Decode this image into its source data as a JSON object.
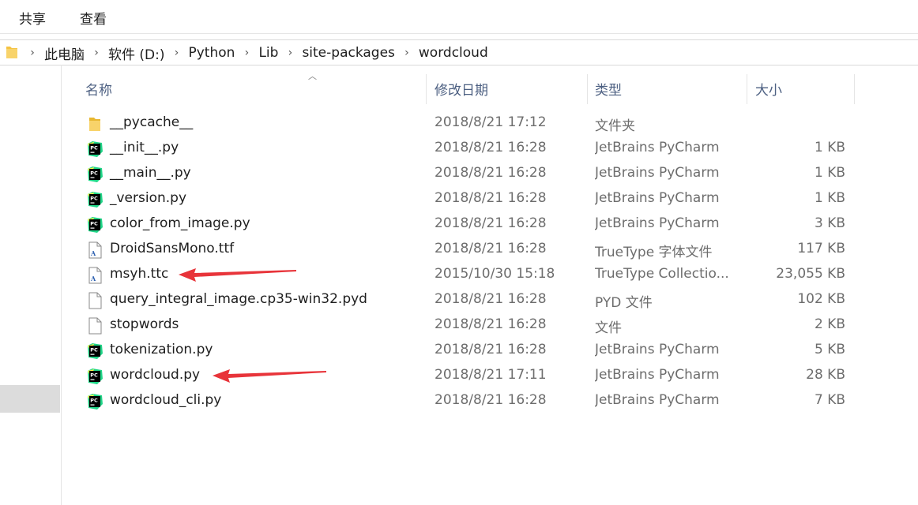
{
  "ribbon": {
    "tabs": [
      "共享",
      "查看"
    ]
  },
  "address": {
    "segments": [
      "此电脑",
      "软件 (D:)",
      "Python",
      "Lib",
      "site-packages",
      "wordcloud"
    ]
  },
  "columns": {
    "name": "名称",
    "date": "修改日期",
    "type": "类型",
    "size": "大小"
  },
  "files": [
    {
      "name": "__pycache__",
      "date": "2018/8/21 17:12",
      "type": "文件夹",
      "size": "",
      "icon": "folder-icon"
    },
    {
      "name": "__init__.py",
      "date": "2018/8/21 16:28",
      "type": "JetBrains PyCharm",
      "size": "1 KB",
      "icon": "pycharm-icon"
    },
    {
      "name": "__main__.py",
      "date": "2018/8/21 16:28",
      "type": "JetBrains PyCharm",
      "size": "1 KB",
      "icon": "pycharm-icon"
    },
    {
      "name": "_version.py",
      "date": "2018/8/21 16:28",
      "type": "JetBrains PyCharm",
      "size": "1 KB",
      "icon": "pycharm-icon"
    },
    {
      "name": "color_from_image.py",
      "date": "2018/8/21 16:28",
      "type": "JetBrains PyCharm",
      "size": "3 KB",
      "icon": "pycharm-icon"
    },
    {
      "name": "DroidSansMono.ttf",
      "date": "2018/8/21 16:28",
      "type": "TrueType 字体文件",
      "size": "117 KB",
      "icon": "font-file-icon"
    },
    {
      "name": "msyh.ttc",
      "date": "2015/10/30 15:18",
      "type": "TrueType Collectio...",
      "size": "23,055 KB",
      "icon": "font-file-icon"
    },
    {
      "name": "query_integral_image.cp35-win32.pyd",
      "date": "2018/8/21 16:28",
      "type": "PYD 文件",
      "size": "102 KB",
      "icon": "blank-file-icon"
    },
    {
      "name": "stopwords",
      "date": "2018/8/21 16:28",
      "type": "文件",
      "size": "2 KB",
      "icon": "blank-file-icon"
    },
    {
      "name": "tokenization.py",
      "date": "2018/8/21 16:28",
      "type": "JetBrains PyCharm",
      "size": "5 KB",
      "icon": "pycharm-icon"
    },
    {
      "name": "wordcloud.py",
      "date": "2018/8/21 17:11",
      "type": "JetBrains PyCharm",
      "size": "28 KB",
      "icon": "pycharm-icon"
    },
    {
      "name": "wordcloud_cli.py",
      "date": "2018/8/21 16:28",
      "type": "JetBrains PyCharm",
      "size": "7 KB",
      "icon": "pycharm-icon"
    }
  ],
  "annotations": {
    "color": "#e8343a",
    "arrow_targets": [
      "msyh.ttc",
      "wordcloud.py"
    ]
  },
  "colors": {
    "header_text": "#4d6082",
    "folder": "#f5c342",
    "nav_selected": "#dcdcdc"
  }
}
